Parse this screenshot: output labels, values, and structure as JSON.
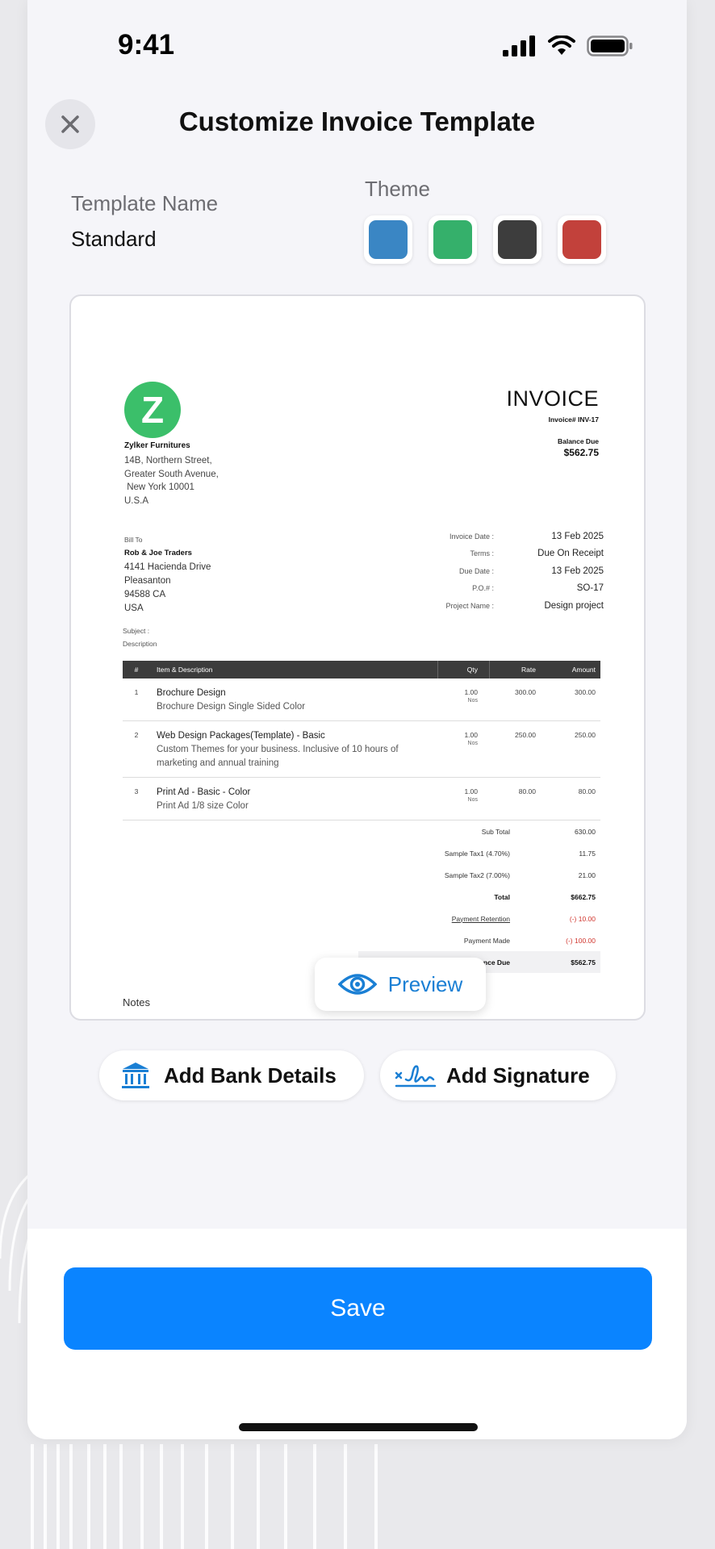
{
  "status": {
    "time": "9:41"
  },
  "header": {
    "title": "Customize Invoice Template"
  },
  "template": {
    "name_label": "Template Name",
    "name_value": "Standard"
  },
  "theme": {
    "label": "Theme",
    "swatches": [
      {
        "name": "blue",
        "color": "#3a86c4"
      },
      {
        "name": "green",
        "color": "#35b06b"
      },
      {
        "name": "dark",
        "color": "#3d3d3d"
      },
      {
        "name": "red",
        "color": "#c2413b"
      }
    ]
  },
  "invoice": {
    "logo_letter": "Z",
    "org_name": "Zylker Furnitures",
    "org_address": [
      "14B, Northern Street,",
      "Greater South Avenue,",
      " New York 10001",
      "U.S.A"
    ],
    "title": "INVOICE",
    "invoice_number": "Invoice# INV-17",
    "balance_due_label": "Balance Due",
    "balance_due_value": "$562.75",
    "bill_to_label": "Bill To",
    "bill_to_name": "Rob & Joe Traders",
    "bill_to_address": [
      "4141 Hacienda Drive",
      "Pleasanton",
      "94588 CA",
      "USA"
    ],
    "meta": [
      {
        "key": "Invoice Date :",
        "value": "13 Feb 2025"
      },
      {
        "key": "Terms :",
        "value": "Due On Receipt"
      },
      {
        "key": "Due Date :",
        "value": "13 Feb 2025"
      },
      {
        "key": "P.O.# :",
        "value": "SO-17"
      },
      {
        "key": "Project Name :",
        "value": "Design project"
      }
    ],
    "subject_label": "Subject :",
    "description_label": "Description",
    "table_headers": {
      "num": "#",
      "item": "Item & Description",
      "qty": "Qty",
      "rate": "Rate",
      "amount": "Amount"
    },
    "items": [
      {
        "num": "1",
        "name": "Brochure Design",
        "desc": "Brochure Design Single Sided Color",
        "qty": "1.00",
        "unit": "Nos",
        "rate": "300.00",
        "amount": "300.00"
      },
      {
        "num": "2",
        "name": "Web Design Packages(Template) - Basic",
        "desc": "Custom Themes for your business. Inclusive of 10 hours of marketing and annual training",
        "qty": "1.00",
        "unit": "Nos",
        "rate": "250.00",
        "amount": "250.00"
      },
      {
        "num": "3",
        "name": "Print Ad - Basic - Color",
        "desc": "Print Ad 1/8 size Color",
        "qty": "1.00",
        "unit": "Nos",
        "rate": "80.00",
        "amount": "80.00"
      }
    ],
    "totals": [
      {
        "key": "Sub Total",
        "value": "630.00",
        "style": ""
      },
      {
        "key": "Sample Tax1 (4.70%)",
        "value": "11.75",
        "style": ""
      },
      {
        "key": "Sample Tax2 (7.00%)",
        "value": "21.00",
        "style": ""
      },
      {
        "key": "Total",
        "value": "$662.75",
        "style": "bold"
      },
      {
        "key": "Payment Retention",
        "value": "(-) 10.00",
        "style": "red link"
      },
      {
        "key": "Payment Made",
        "value": "(-) 100.00",
        "style": "red"
      },
      {
        "key": "Balance Due",
        "value": "$562.75",
        "style": "bold shade"
      }
    ],
    "notes_label": "Notes"
  },
  "preview": {
    "label": "Preview"
  },
  "actions": {
    "bank_label": "Add Bank Details",
    "signature_label": "Add Signature"
  },
  "footer": {
    "save_label": "Save"
  },
  "colors": {
    "accent": "#0a84ff",
    "preview_text": "#1a7fd4",
    "negative": "#d0342c"
  }
}
